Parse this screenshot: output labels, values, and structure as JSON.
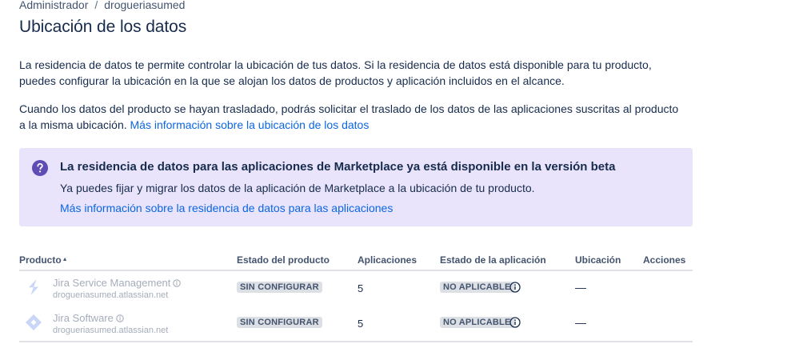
{
  "breadcrumb": {
    "items": [
      "Administrador",
      "drogueriasumed"
    ],
    "separator": "/"
  },
  "page": {
    "title": "Ubicación de los datos",
    "intro_text": "La residencia de datos te permite controlar la ubicación de tus datos. Si la residencia de datos está disponible para tu producto, puedes configurar la ubicación en la que se alojan los datos de productos y aplicación incluidos en el alcance.",
    "move_text": "Cuando los datos del producto se hayan trasladado, podrás solicitar el traslado de los datos de las aplicaciones suscritas al producto a la misma ubicación.",
    "learn_more_link": "Más información sobre la ubicación de los datos"
  },
  "banner": {
    "icon": "question-circle-icon",
    "title": "La residencia de datos para las aplicaciones de Marketplace ya está disponible en la versión beta",
    "description": "Ya puedes fijar y migrar los datos de la aplicación de Marketplace a la ubicación de tu producto.",
    "link": "Más información sobre la residencia de datos para las aplicaciones",
    "color": "#e9e4fb"
  },
  "table": {
    "headers": {
      "product": "Producto",
      "product_sort_glyph": "▲",
      "product_status": "Estado del producto",
      "apps": "Aplicaciones",
      "app_status": "Estado de la aplicación",
      "location": "Ubicación",
      "actions": "Acciones"
    },
    "rows": [
      {
        "product_name": "Jira Service Management",
        "product_icon": "jira-service-management-icon",
        "site": "drogueriasumed.atlassian.net",
        "product_status": "SIN CONFIGURAR",
        "apps": "5",
        "app_status": "NO APLICABLE",
        "location": "—"
      },
      {
        "product_name": "Jira Software",
        "product_icon": "jira-software-icon",
        "site": "drogueriasumed.atlassian.net",
        "product_status": "SIN CONFIGURAR",
        "apps": "5",
        "app_status": "NO APLICABLE",
        "location": "—"
      }
    ]
  },
  "colors": {
    "link": "#0c66e4",
    "text": "#172b4d",
    "muted": "#a5adba",
    "product_icon": "#c9d6f5",
    "banner_icon": "#5e4db2"
  }
}
